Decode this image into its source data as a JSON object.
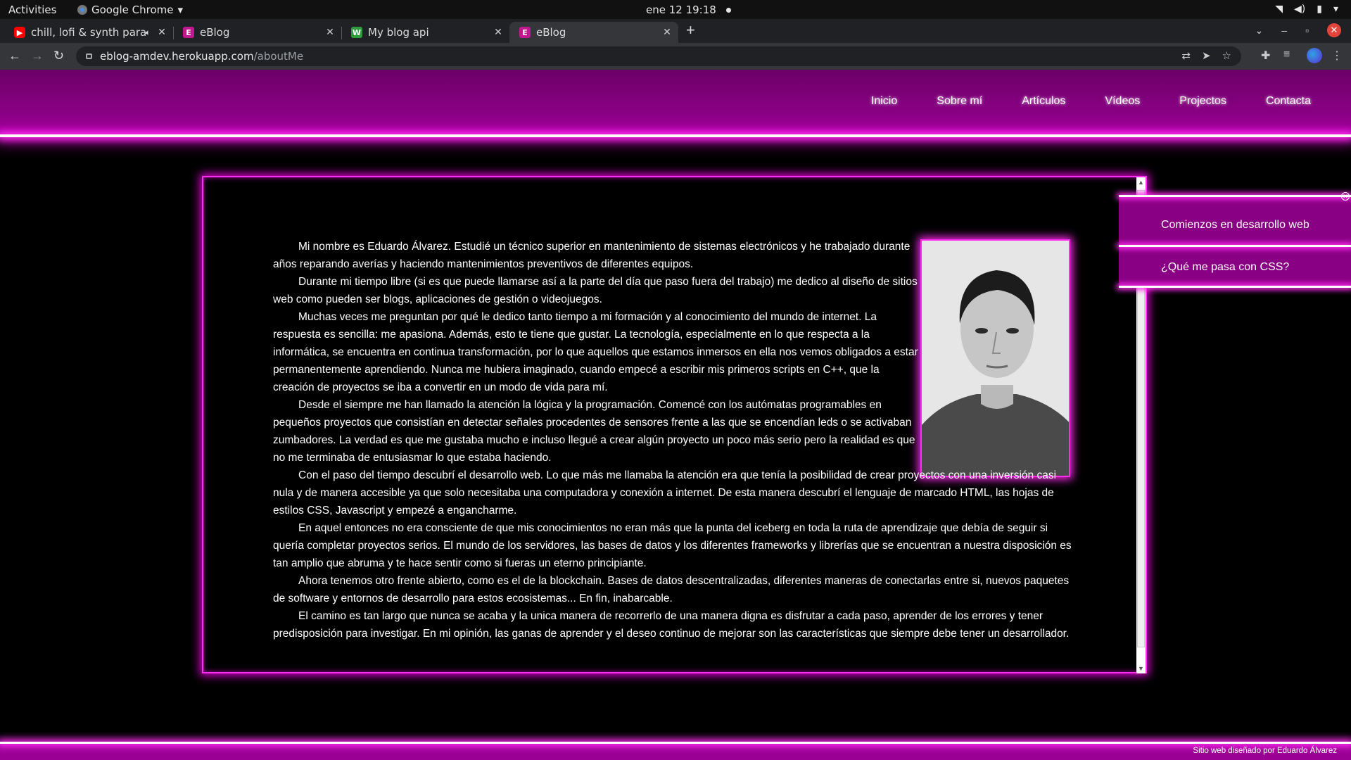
{
  "os_topbar": {
    "activities": "Activities",
    "app_name": "Google Chrome",
    "clock": "ene 12  19:18",
    "sys_icons": [
      "wifi-icon",
      "volume-icon",
      "battery-icon",
      "power-menu-icon"
    ]
  },
  "browser": {
    "tabs": [
      {
        "title": "chill, lofi & synth para j",
        "favicon": "youtube-icon",
        "favicon_color": "#ff0000",
        "muted": true,
        "active": false
      },
      {
        "title": "eBlog",
        "favicon": "E",
        "favicon_color": "#c2188f",
        "active": false
      },
      {
        "title": "My blog api",
        "favicon": "W",
        "favicon_color": "#2e9d3a",
        "active": false
      },
      {
        "title": "eBlog",
        "favicon": "E",
        "favicon_color": "#c2188f",
        "active": true
      }
    ],
    "url_host": "eblog-amdev.herokuapp.com",
    "url_path": "/aboutMe"
  },
  "site": {
    "nav": [
      "Inicio",
      "Sobre mí",
      "Artículos",
      "Vídeos",
      "Projectos",
      "Contacta"
    ],
    "about_paragraphs": [
      "Mi nombre es Eduardo Álvarez. Estudié un técnico superior en mantenimiento de sistemas electrónicos y he trabajado durante años reparando averías y haciendo mantenimientos preventivos de diferentes equipos.",
      "Durante mi tiempo libre (si es que puede llamarse así a la parte del día que paso fuera del trabajo) me dedico al diseño de sitios web como pueden ser blogs, aplicaciones de gestión o videojuegos.",
      "Muchas veces me preguntan por qué le dedico tanto tiempo a mi formación y al conocimiento del mundo de internet. La respuesta es sencilla: me apasiona. Además, esto te tiene que gustar. La tecnología, especialmente en lo que respecta a la informática, se encuentra en continua transformación, por lo que aquellos que estamos inmersos en ella nos vemos obligados a estar permanentemente aprendiendo. Nunca me hubiera imaginado, cuando empecé a escribir mis primeros scripts en C++, que la creación de proyectos se iba a convertir en un modo de vida para mí.",
      "Desde el siempre me han llamado la atención la lógica y la programación. Comencé con los autómatas programables en pequeños proyectos que consistían en detectar señales procedentes de sensores frente a las que se encendían leds o se activaban zumbadores. La verdad es que me gustaba mucho e incluso llegué a crear algún proyecto un poco más serio pero la realidad es que no me terminaba de entusiasmar lo que estaba haciendo.",
      "Con el paso del tiempo descubrí el desarrollo web. Lo que más me llamaba la atención era que tenía la posibilidad de crear proyectos con una inversión casi nula y de manera accesible ya que solo necesitaba una computadora y conexión a internet. De esta manera descubrí el lenguaje de marcado HTML, las hojas de estilos CSS, Javascript y empezé a engancharme.",
      "En aquel entonces no era consciente de que mis conocimientos no eran más que la punta del iceberg en toda la ruta de aprendizaje que debía de seguir si quería completar proyectos serios.  El mundo de los servidores, las bases de datos y los diferentes frameworks y librerías que se encuentran a nuestra disposición es tan amplio que abruma y te hace sentir como si fueras un eterno principiante.",
      "Ahora tenemos otro frente abierto, como es el de la blockchain. Bases de datos descentralizadas, diferentes maneras de conectarlas entre si, nuevos paquetes de software y entornos de desarrollo para estos ecosistemas... En fin, inabarcable.",
      "El camino es tan largo que nunca se acaba y la unica manera de recorrerlo de una manera digna es disfrutar a cada paso, aprender de los errores y tener predisposición para investigar. En mi opinión, las ganas de aprender y el deseo continuo de mejorar son las características que siempre debe tener un desarrollador."
    ],
    "side_articles": [
      "Comienzos en desarrollo web",
      "¿Qué me pasa con CSS?"
    ],
    "footer_credit": "Sitio web diseñado por Eduardo Álvarez",
    "accent_color": "#ff2bf0",
    "header_color": "#9a0094"
  }
}
